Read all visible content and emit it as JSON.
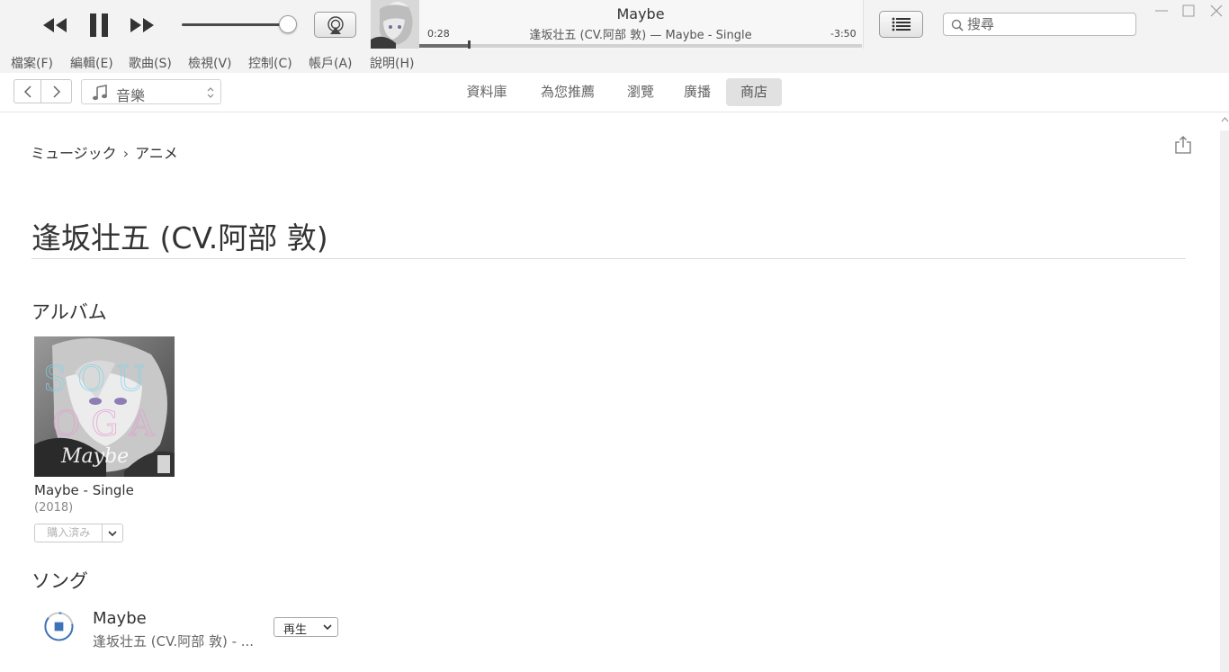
{
  "player": {
    "now_playing_title": "Maybe",
    "now_playing_subtitle": "逢坂壮五 (CV.阿部 敦) — Maybe - Single",
    "elapsed": "0:28",
    "remaining": "-3:50",
    "progress_fraction": 0.114,
    "volume_fraction": 0.92,
    "search_placeholder": "搜尋"
  },
  "menu": [
    "檔案(F)",
    "編輯(E)",
    "歌曲(S)",
    "檢視(V)",
    "控制(C)",
    "帳戶(A)",
    "說明(H)"
  ],
  "nav": {
    "media_selector": "音樂",
    "tabs": [
      "資料庫",
      "為您推薦",
      "瀏覽",
      "廣播",
      "商店"
    ],
    "active_tab": "商店"
  },
  "page": {
    "breadcrumb": [
      "ミュージック",
      "アニメ"
    ],
    "title": "逢坂壮五 (CV.阿部 敦)",
    "albums_heading": "アルバム",
    "songs_heading": "ソング"
  },
  "album": {
    "name": "Maybe - Single",
    "year": "(2018)",
    "status_label": "購入済み",
    "art_text": "Maybe"
  },
  "song": {
    "title": "Maybe",
    "artist": "逢坂壮五 (CV.阿部 敦) - ...",
    "action_label": "再生"
  },
  "colors": {
    "chrome_bg": "#f3f3f3",
    "active_tab_bg": "#e1e1e1",
    "stop_icon_blue": "#3d73b9"
  }
}
